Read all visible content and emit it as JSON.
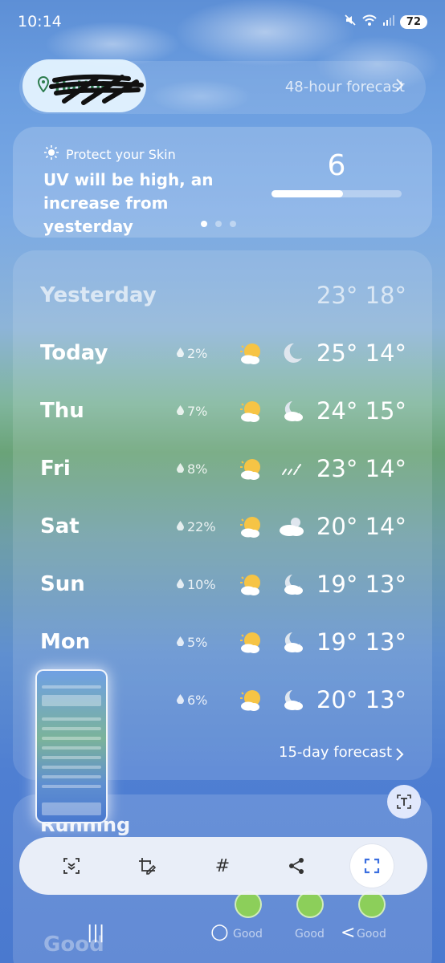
{
  "status_bar": {
    "time": "10:14",
    "battery": "72",
    "icons": [
      "mute-icon",
      "wifi-icon",
      "signal-icon"
    ]
  },
  "location": {
    "name": "Hatton",
    "forecast_48_label": "48-hour forecast"
  },
  "uv": {
    "heading": "Protect your Skin",
    "message": "UV will be high, an increase from yesterday",
    "value": "6",
    "level_fraction": 0.55,
    "page_index": 0,
    "page_count": 3
  },
  "forecast": {
    "yesterday": {
      "label": "Yesterday",
      "temps": "23° 18°"
    },
    "days": [
      {
        "label": "Today",
        "precip": "2%",
        "day_icon": "partly-cloudy-icon",
        "night_icon": "moon-icon",
        "temps": "25° 14°"
      },
      {
        "label": "Thu",
        "precip": "7%",
        "day_icon": "partly-cloudy-icon",
        "night_icon": "night-cloudy-icon",
        "temps": "24° 15°"
      },
      {
        "label": "Fri",
        "precip": "8%",
        "day_icon": "partly-cloudy-icon",
        "night_icon": "rain-icon",
        "temps": "23° 14°"
      },
      {
        "label": "Sat",
        "precip": "22%",
        "day_icon": "partly-cloudy-icon",
        "night_icon": "cloudy-icon",
        "temps": "20° 14°"
      },
      {
        "label": "Sun",
        "precip": "10%",
        "day_icon": "partly-cloudy-icon",
        "night_icon": "night-cloudy-icon",
        "temps": "19° 13°"
      },
      {
        "label": "Mon",
        "precip": "5%",
        "day_icon": "partly-cloudy-icon",
        "night_icon": "night-cloudy-icon",
        "temps": "19° 13°"
      },
      {
        "label": "",
        "precip": "6%",
        "day_icon": "partly-cloudy-icon",
        "night_icon": "night-cloudy-icon",
        "temps": "20° 13°"
      }
    ],
    "fifteen_day_label": "15-day forecast"
  },
  "running": {
    "label": "Running",
    "good_labels": [
      "Good",
      "Good",
      "Good"
    ],
    "big_good": "Good"
  },
  "toolbar": {
    "buttons": [
      "scroll-capture-icon",
      "edit-crop-icon",
      "hashtag-icon",
      "share-icon",
      "capture-select-icon"
    ],
    "hashtag_glyph": "#"
  },
  "navigation": {
    "recent": "|||",
    "home": "○",
    "back": "<"
  }
}
